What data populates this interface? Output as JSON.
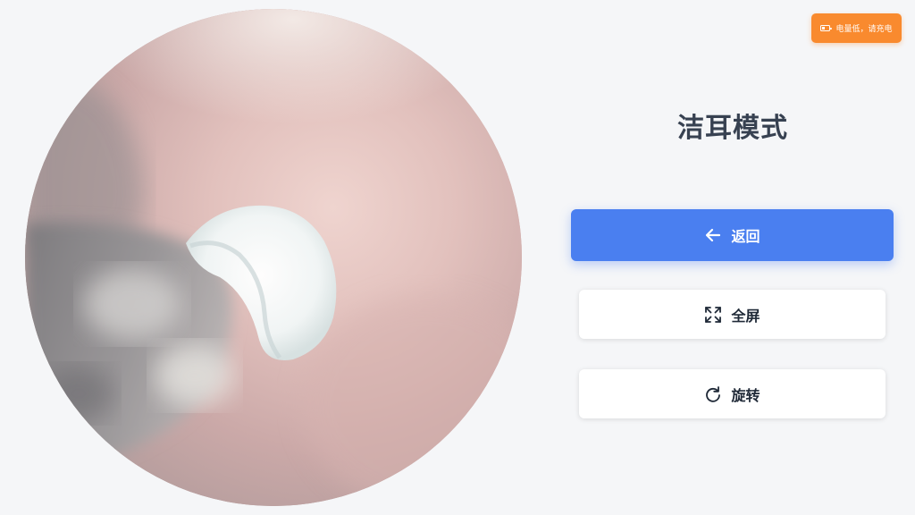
{
  "battery": {
    "text": "电量低，请充电",
    "icon": "battery-low-icon",
    "color": "#f98a2e"
  },
  "mode": {
    "title": "洁耳模式"
  },
  "buttons": {
    "back": {
      "label": "返回",
      "icon": "arrow-left-icon",
      "color": "#4a7ff0"
    },
    "fullscreen": {
      "label": "全屏",
      "icon": "expand-icon"
    },
    "rotate": {
      "label": "旋转",
      "icon": "rotate-icon"
    }
  }
}
